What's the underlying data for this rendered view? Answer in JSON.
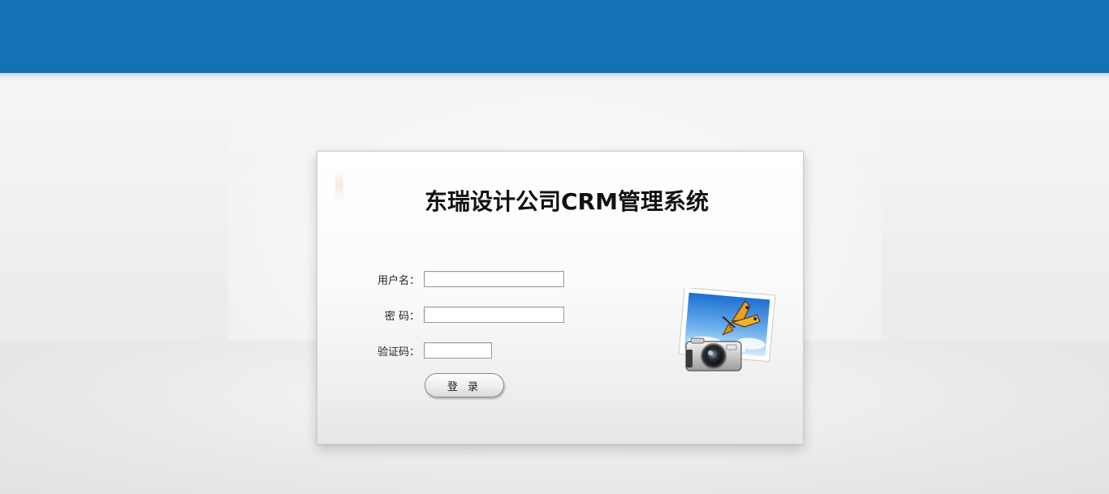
{
  "header": {
    "band_color": "#1570b5"
  },
  "login": {
    "title": "东瑞设计公司CRM管理系统",
    "username_label": "用户名：",
    "password_label": "密 码：",
    "captcha_label": "验证码：",
    "username_value": "",
    "password_value": "",
    "captcha_value": "",
    "submit_label": "登 录"
  },
  "illustration": {
    "icon": "camera-photo-icon"
  }
}
